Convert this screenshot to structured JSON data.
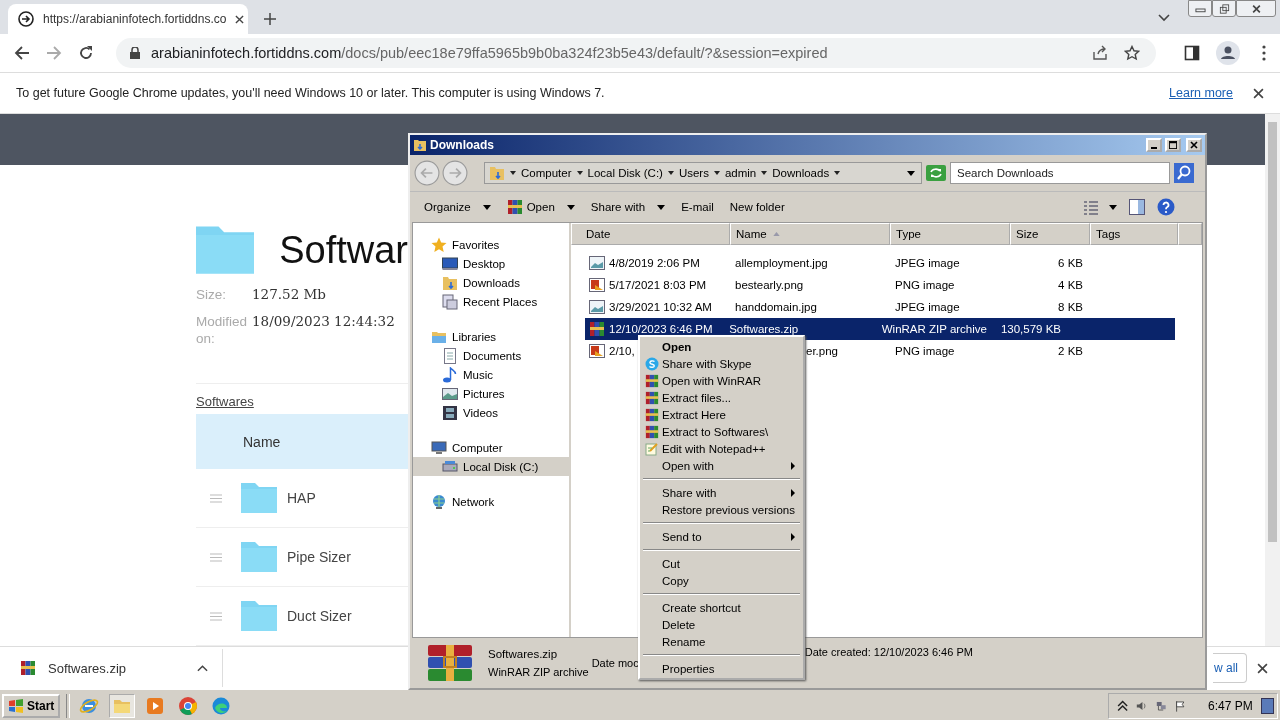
{
  "browser": {
    "tab_title": "https://arabianinfotech.fortiddns.co",
    "url_host": "arabianinfotech.fortiddns.com",
    "url_path": "/docs/pub/eec18e79ffa5965b9b0ba324f23b5e43/default/?&session=expired",
    "infobar": {
      "message": "To get future Google Chrome updates, you'll need Windows 10 or later. This computer is using Windows 7.",
      "link": "Learn more"
    }
  },
  "page": {
    "title": "Softwar",
    "size_label": "Size:",
    "size": "127.52 Mb",
    "modified_label": "Modified on:",
    "modified": "18/09/2023 12:44:32",
    "breadcrumb": "Softwares",
    "column": "Name",
    "rows": [
      "HAP",
      "Pipe Sizer",
      "Duct Sizer"
    ]
  },
  "downloads": {
    "file": "Softwares.zip",
    "show_all": "w all"
  },
  "explorer": {
    "title": "Downloads",
    "breadcrumb": [
      "Computer",
      "Local Disk (C:)",
      "Users",
      "admin",
      "Downloads"
    ],
    "search_placeholder": "Search Downloads",
    "toolbar": [
      {
        "label": "Organize",
        "kind": "menu"
      },
      {
        "label": "Open",
        "kind": "app-menu"
      },
      {
        "label": "Share with",
        "kind": "menu"
      },
      {
        "label": "E-mail",
        "kind": "plain"
      },
      {
        "label": "New folder",
        "kind": "plain"
      }
    ],
    "nav": [
      {
        "label": "Favorites",
        "kind": "star",
        "selected": false,
        "children": [
          {
            "label": "Desktop",
            "kind": "desktop",
            "selected": false
          },
          {
            "label": "Downloads",
            "kind": "downloads",
            "selected": false
          },
          {
            "label": "Recent Places",
            "kind": "recent",
            "selected": false
          }
        ]
      },
      {
        "label": "Libraries",
        "kind": "library",
        "selected": false,
        "children": [
          {
            "label": "Documents",
            "kind": "document",
            "selected": false
          },
          {
            "label": "Music",
            "kind": "music",
            "selected": false
          },
          {
            "label": "Pictures",
            "kind": "pictures",
            "selected": false
          },
          {
            "label": "Videos",
            "kind": "videos",
            "selected": false
          }
        ]
      },
      {
        "label": "Computer",
        "kind": "computer",
        "selected": false,
        "children": [
          {
            "label": "Local Disk (C:)",
            "kind": "disk",
            "selected": true
          }
        ]
      },
      {
        "label": "Network",
        "kind": "network",
        "selected": false
      }
    ],
    "columns": [
      {
        "label": "Date",
        "sorted": false
      },
      {
        "label": "Name",
        "sorted": true
      },
      {
        "label": "Type",
        "sorted": false
      },
      {
        "label": "Size",
        "sorted": false
      },
      {
        "label": "Tags",
        "sorted": false
      }
    ],
    "files": [
      {
        "kind": "jpg",
        "date": "4/8/2019 2:06 PM",
        "name": "allemployment.jpg",
        "type": "JPEG image",
        "size": "6 KB",
        "selected": false,
        "name_after_menu": false
      },
      {
        "kind": "png",
        "date": "5/17/2021 8:03 PM",
        "name": "bestearly.png",
        "type": "PNG image",
        "size": "4 KB",
        "selected": false,
        "name_after_menu": false
      },
      {
        "kind": "jpg",
        "date": "3/29/2021 10:32 AM",
        "name": "handdomain.jpg",
        "type": "JPEG image",
        "size": "8 KB",
        "selected": false,
        "name_after_menu": false
      },
      {
        "kind": "zip",
        "date": "12/10/2023 6:46 PM",
        "name": "Softwares.zip",
        "type": "WinRAR ZIP archive",
        "size": "130,579 KB",
        "selected": true,
        "name_after_menu": false
      },
      {
        "kind": "png",
        "date": "2/10,",
        "name": "er.png",
        "type": "PNG image",
        "size": "2 KB",
        "selected": false,
        "name_after_menu": true
      }
    ],
    "details": {
      "name": "Softwares.zip",
      "type": "WinRAR ZIP archive",
      "modified_label": "Date moc",
      "created": "Date created:  12/10/2023 6:46 PM"
    },
    "context_menu": [
      [
        {
          "label": "Open",
          "kind": "plain",
          "default": true,
          "submenu": false
        },
        {
          "label": "Share with Skype",
          "kind": "skype",
          "default": false,
          "submenu": false
        },
        {
          "label": "Open with WinRAR",
          "kind": "winrar",
          "default": false,
          "submenu": false
        },
        {
          "label": "Extract files...",
          "kind": "winrar",
          "default": false,
          "submenu": false
        },
        {
          "label": "Extract Here",
          "kind": "winrar",
          "default": false,
          "submenu": false
        },
        {
          "label": "Extract to Softwares\\",
          "kind": "winrar",
          "default": false,
          "submenu": false
        },
        {
          "label": "Edit with Notepad++",
          "kind": "notepad",
          "default": false,
          "submenu": false
        },
        {
          "label": "Open with",
          "kind": "plain",
          "default": false,
          "submenu": true
        }
      ],
      [
        {
          "label": "Share with",
          "kind": "plain",
          "default": false,
          "submenu": true
        },
        {
          "label": "Restore previous versions",
          "kind": "plain",
          "default": false,
          "submenu": false
        }
      ],
      [
        {
          "label": "Send to",
          "kind": "plain",
          "default": false,
          "submenu": true
        }
      ],
      [
        {
          "label": "Cut",
          "kind": "plain",
          "default": false,
          "submenu": false
        },
        {
          "label": "Copy",
          "kind": "plain",
          "default": false,
          "submenu": false
        }
      ],
      [
        {
          "label": "Create shortcut",
          "kind": "plain",
          "default": false,
          "submenu": false
        },
        {
          "label": "Delete",
          "kind": "plain",
          "default": false,
          "submenu": false
        },
        {
          "label": "Rename",
          "kind": "plain",
          "default": false,
          "submenu": false
        }
      ],
      [
        {
          "label": "Properties",
          "kind": "plain",
          "default": false,
          "submenu": false
        }
      ]
    ]
  },
  "taskbar": {
    "start": "Start",
    "apps": [
      {
        "kind": "ie",
        "active": false
      },
      {
        "kind": "explorer",
        "active": true
      },
      {
        "kind": "media",
        "active": false
      },
      {
        "kind": "chrome",
        "active": false
      },
      {
        "kind": "edge",
        "active": false
      }
    ],
    "time": "6:47 PM"
  }
}
